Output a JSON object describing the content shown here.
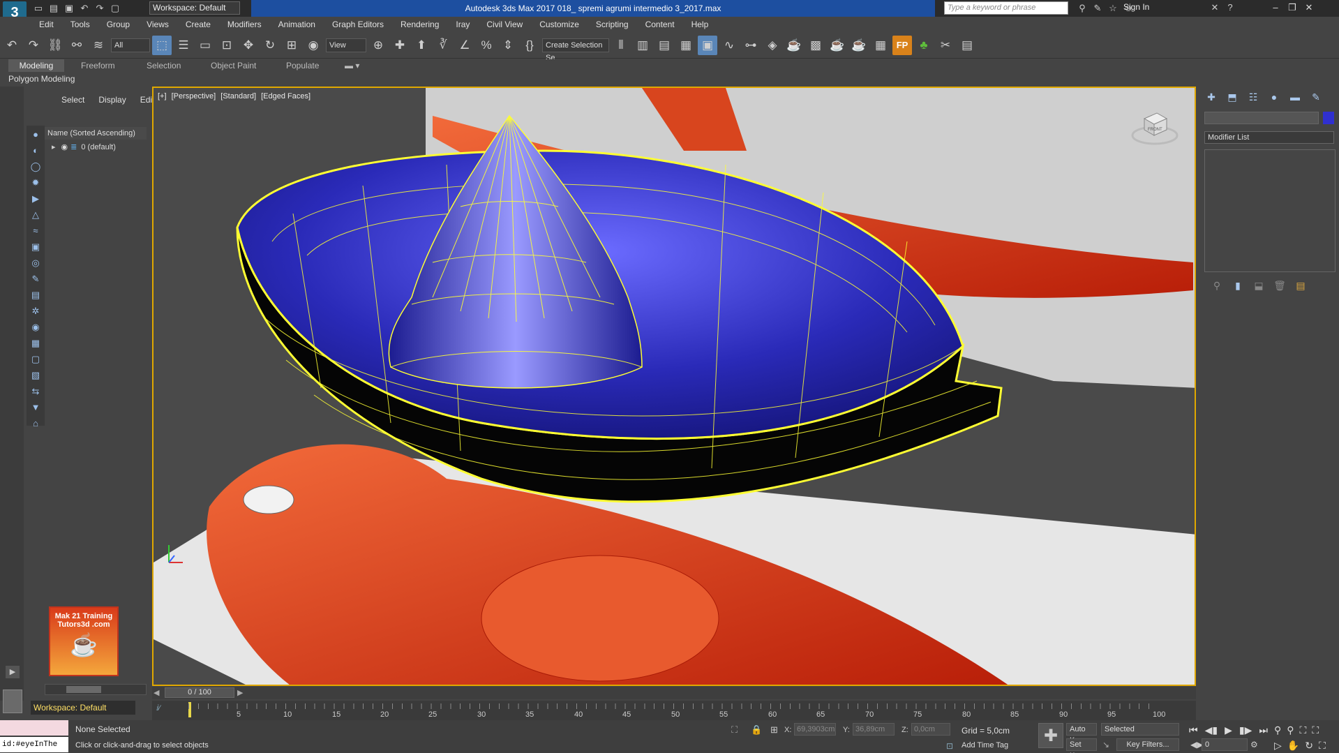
{
  "app": {
    "logo_text": "3",
    "window_title": "Autodesk 3ds Max 2017     018_ spremi agrumi intermedio 3_2017.max",
    "workspace_label": "Workspace: Default",
    "search_placeholder": "Type a keyword or phrase",
    "sign_in": "Sign In"
  },
  "menu": [
    "Edit",
    "Tools",
    "Group",
    "Views",
    "Create",
    "Modifiers",
    "Animation",
    "Graph Editors",
    "Rendering",
    "Iray",
    "Civil View",
    "Customize",
    "Scripting",
    "Content",
    "Help"
  ],
  "toolbar": {
    "selection_filter": "All",
    "ref_coord": "View",
    "named_selection": "Create Selection Se",
    "fp_label": "FP"
  },
  "ribbon": {
    "tabs": [
      "Modeling",
      "Freeform",
      "Selection",
      "Object Paint",
      "Populate"
    ],
    "panel_label": "Polygon Modeling"
  },
  "explorer": {
    "tabs": [
      "Select",
      "Display",
      "Edit"
    ],
    "column_header": "Name (Sorted Ascending)",
    "layer_row": "0 (default)",
    "logo_line1": "Mak 21 Training",
    "logo_line2": "Tutors3d .com",
    "workspace_status": "Workspace: Default"
  },
  "viewport": {
    "label_plus": "[+]",
    "label_view": "[Perspective]",
    "label_shading": "[Standard]",
    "label_mode": "[Edged Faces]",
    "viewcube_face": "FRONT"
  },
  "command_panel": {
    "modifier_list": "Modifier List"
  },
  "timeline": {
    "frame_display": "0 / 100",
    "ticks": [
      "5",
      "10",
      "15",
      "20",
      "25",
      "30",
      "35",
      "40",
      "45",
      "50",
      "55",
      "60",
      "65",
      "70",
      "75",
      "80",
      "85",
      "90",
      "95",
      "100"
    ]
  },
  "status": {
    "listener_text": "id:#eyeInThe",
    "selection": "None Selected",
    "prompt": "Click or click-and-drag to select objects",
    "x_label": "X:",
    "x_value": "69,3903cm",
    "y_label": "Y:",
    "y_value": "36,89cm",
    "z_label": "Z:",
    "z_value": "0,0cm",
    "grid": "Grid = 5,0cm",
    "add_time_tag": "Add Time Tag",
    "auto_key": "Auto Key",
    "set_key": "Set Key",
    "selected_dropdown": "Selected",
    "key_filters": "Key Filters...",
    "current_frame": "0"
  },
  "colors": {
    "title_strip": "#1d4fa0",
    "bowl_inner": "#2a2ab0",
    "wire": "#ffff33",
    "reference_red": "#d22a10"
  }
}
